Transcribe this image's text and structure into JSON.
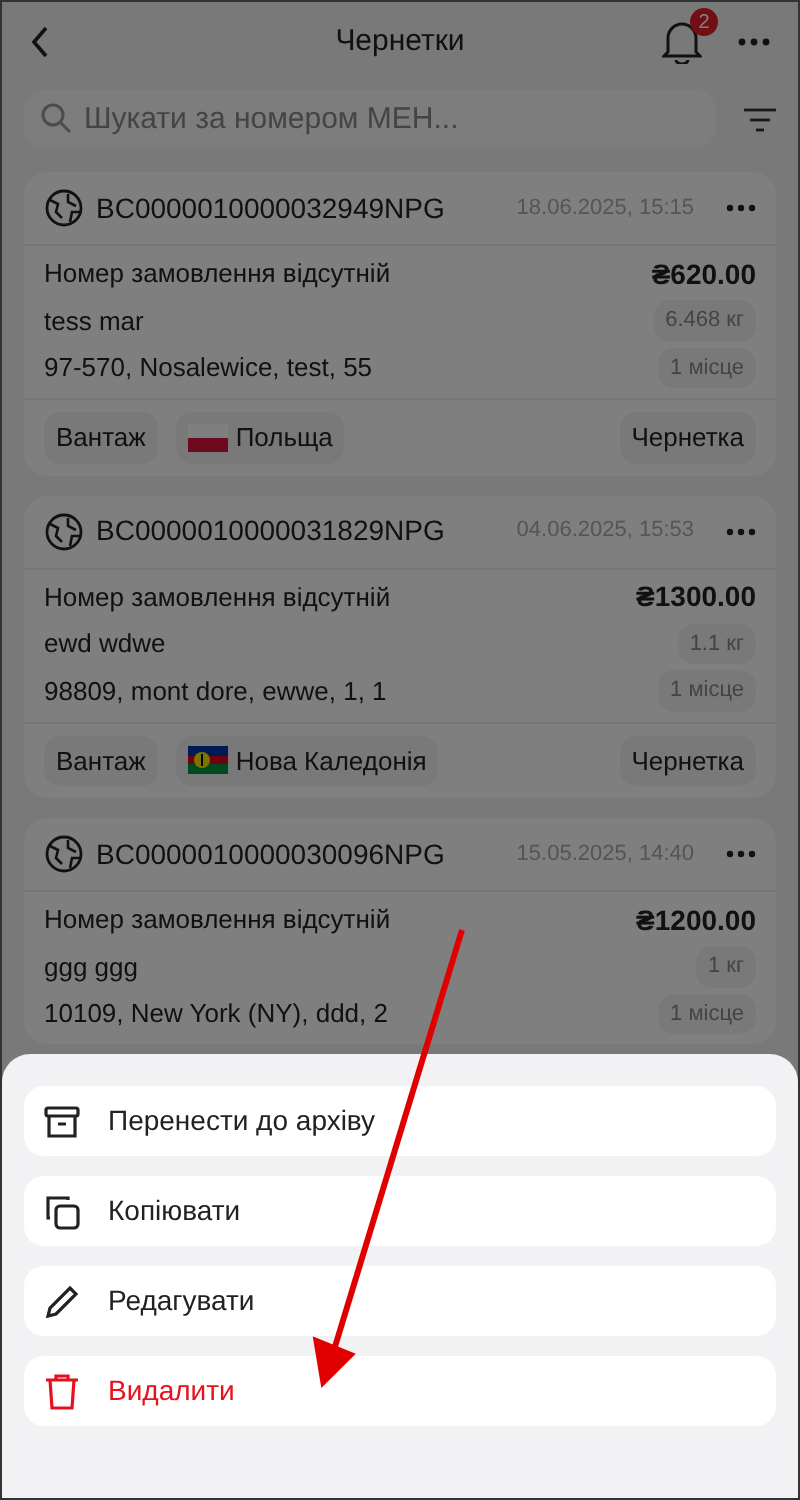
{
  "header": {
    "title": "Чернетки",
    "notification_count": "2"
  },
  "search": {
    "placeholder": "Шукати за номером МЕН..."
  },
  "cards": [
    {
      "number": "BC0000010000032949NPG",
      "date": "18.06.2025, 15:15",
      "order": "Номер замовлення відсутній",
      "price": "₴620.00",
      "recipient": "tess mar",
      "weight": "6.468 кг",
      "address": "97-570, Nosalewice, test, 55",
      "places": "1 місце",
      "footer": {
        "type": "Вантаж",
        "country": {
          "kind": "poland",
          "name": "Польща"
        },
        "status": "Чернетка"
      }
    },
    {
      "number": "BC0000010000031829NPG",
      "date": "04.06.2025, 15:53",
      "order": "Номер замовлення відсутній",
      "price": "₴1300.00",
      "recipient": "ewd wdwe",
      "weight": "1.1 кг",
      "address": "98809, mont dore, ewwe, 1, 1",
      "places": "1 місце",
      "footer": {
        "type": "Вантаж",
        "country": {
          "kind": "new_caledonia",
          "name": "Нова Каледонія"
        },
        "status": "Чернетка"
      }
    },
    {
      "number": "BC0000010000030096NPG",
      "date": "15.05.2025, 14:40",
      "order": "Номер замовлення відсутній",
      "price": "₴1200.00",
      "recipient": "ggg ggg",
      "weight": "1 кг",
      "address": "10109, New York (NY), ddd, 2",
      "places": "1 місце"
    }
  ],
  "action_sheet": [
    {
      "kind": "archive",
      "label": "Перенести до архіву"
    },
    {
      "kind": "copy",
      "label": "Копіювати"
    },
    {
      "kind": "edit",
      "label": "Редагувати"
    },
    {
      "kind": "delete",
      "label": "Видалити"
    }
  ]
}
